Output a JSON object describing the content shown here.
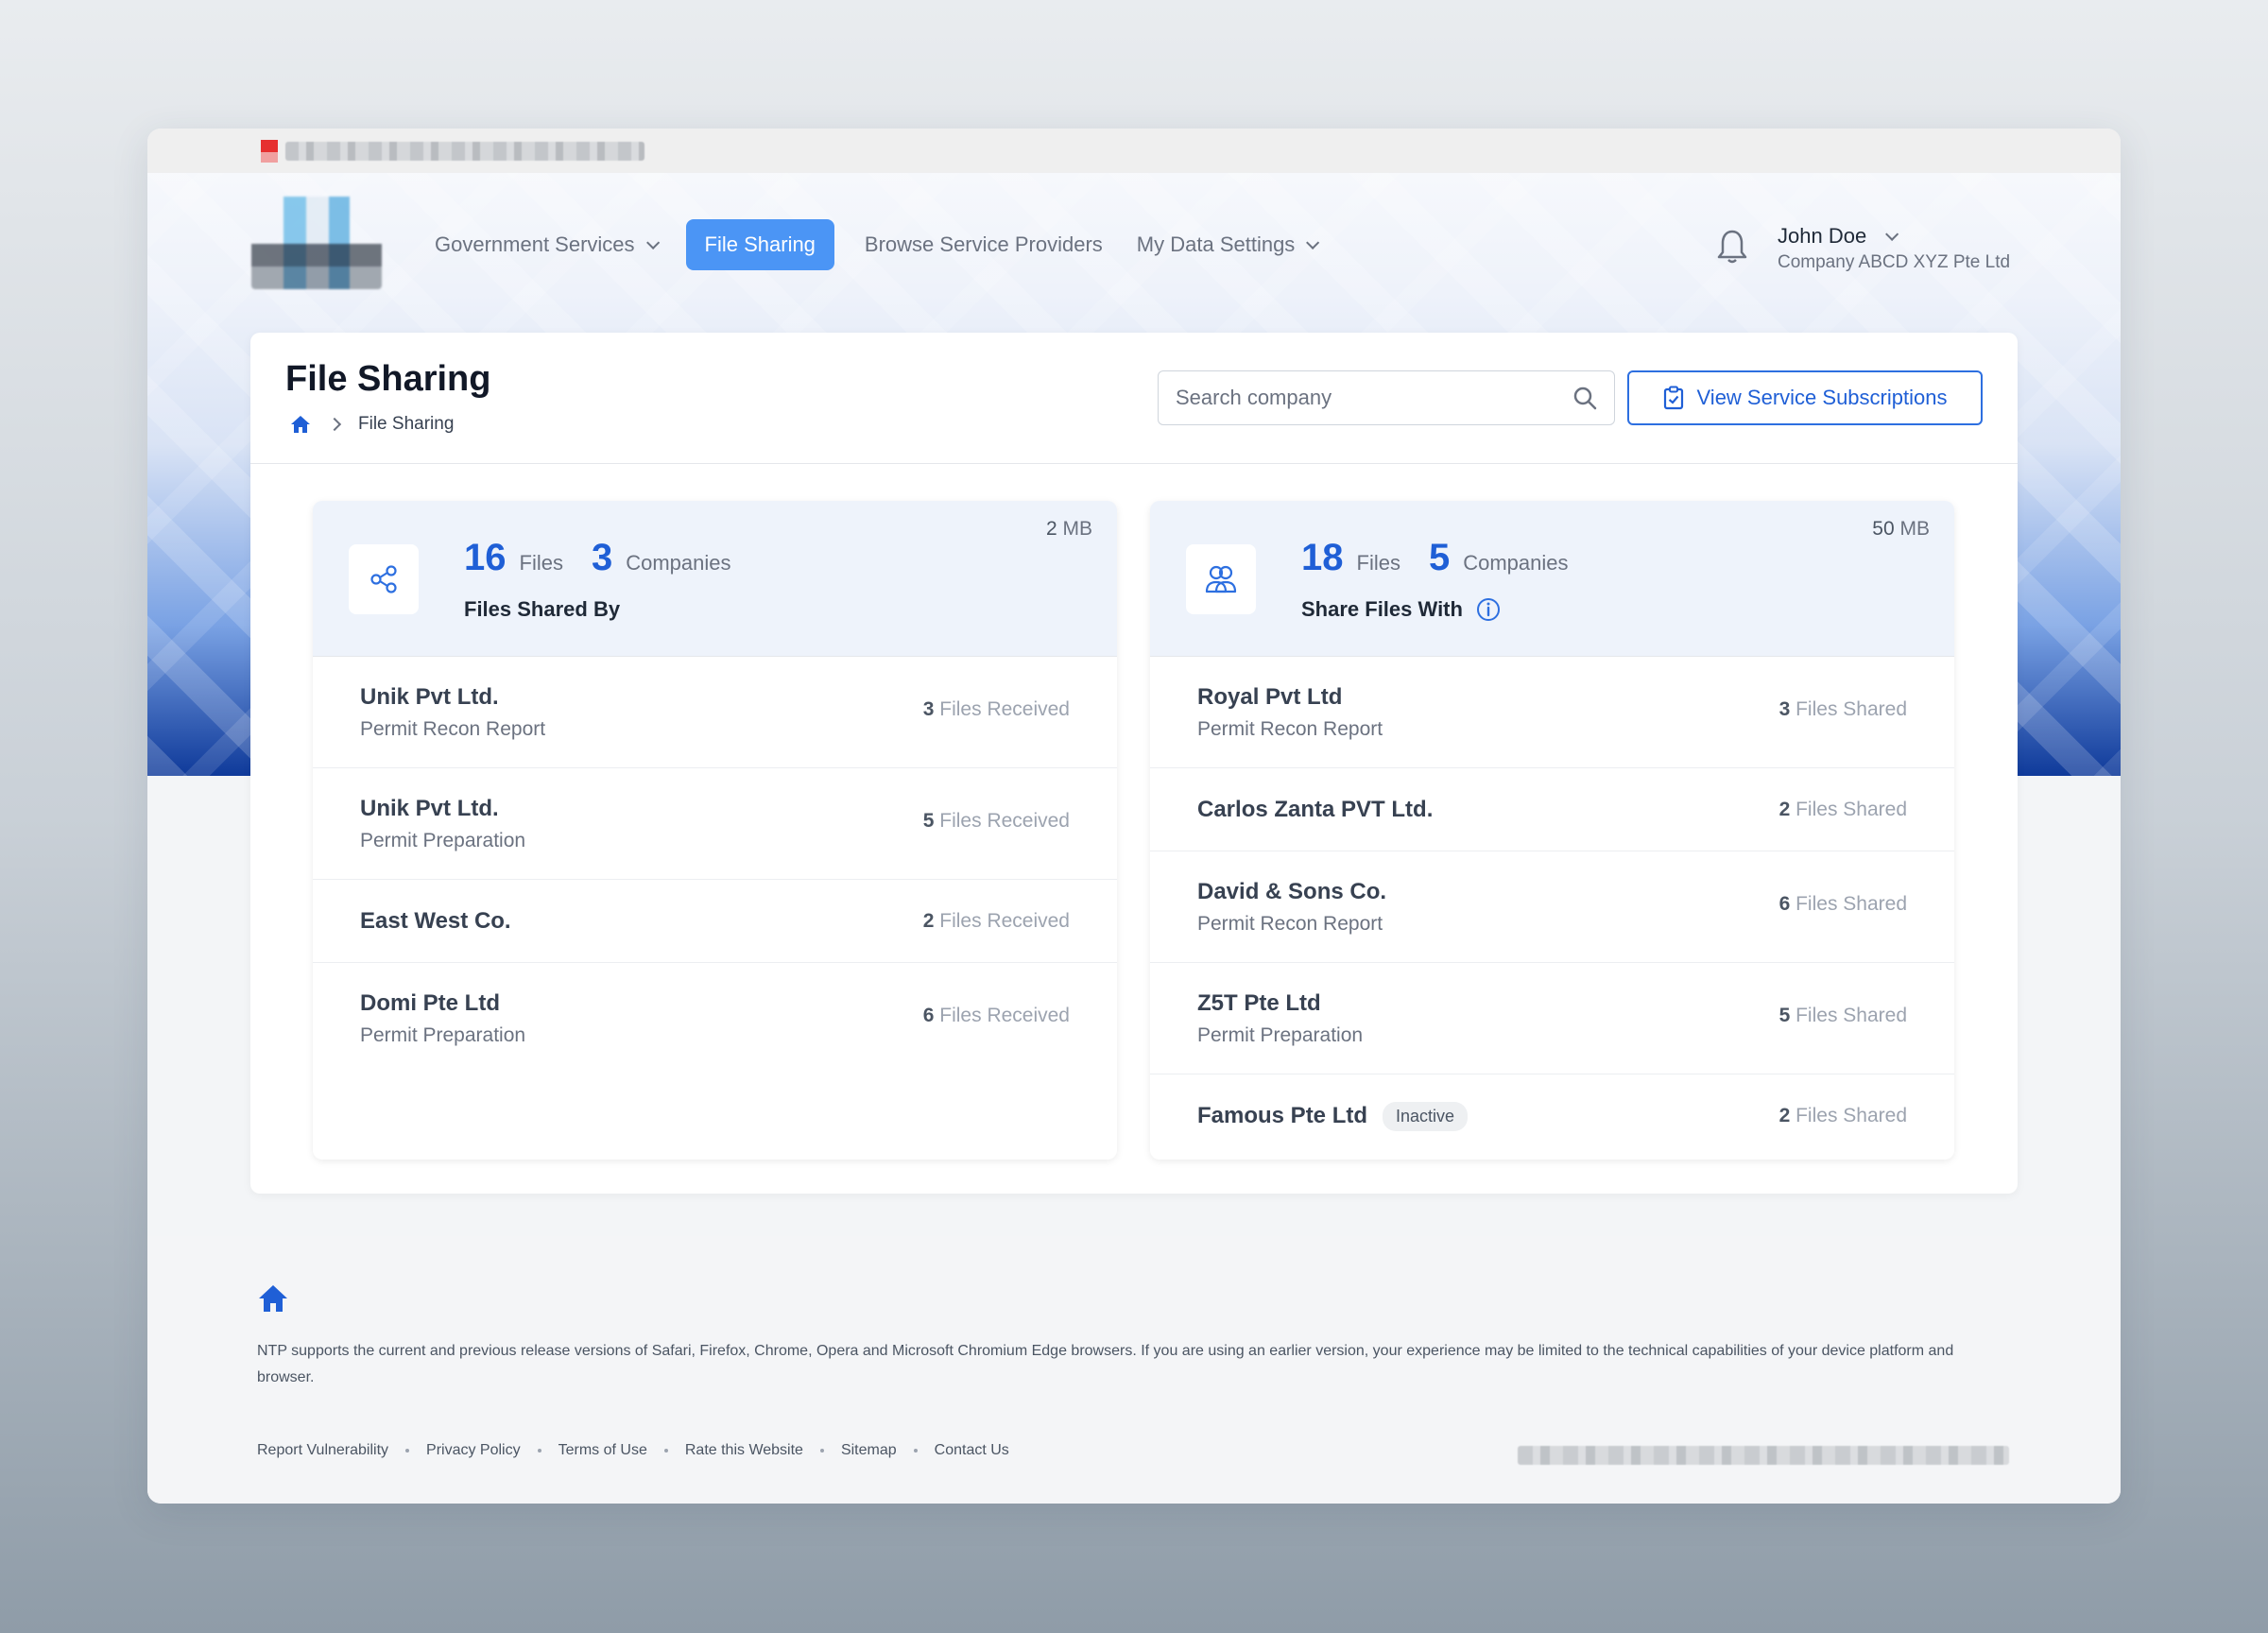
{
  "nav": {
    "items": [
      {
        "label": "Government Services",
        "dropdown": true
      },
      {
        "label": "File Sharing",
        "active": true
      },
      {
        "label": "Browse Service Providers"
      },
      {
        "label": "My Data Settings",
        "dropdown": true
      }
    ]
  },
  "user": {
    "name": "John Doe",
    "company": "Company ABCD XYZ Pte Ltd"
  },
  "page": {
    "title": "File Sharing",
    "breadcrumb": "File Sharing"
  },
  "search": {
    "placeholder": "Search company"
  },
  "subscriptions_button": "View Service Subscriptions",
  "shared_by": {
    "files": "16",
    "files_label": "Files",
    "companies": "3",
    "companies_label": "Companies",
    "title": "Files Shared By",
    "size_value": "2",
    "size_unit": "MB",
    "rows": [
      {
        "company": "Unik Pvt Ltd.",
        "detail": "Permit Recon Report",
        "count": "3",
        "count_label": "Files Received"
      },
      {
        "company": "Unik Pvt Ltd.",
        "detail": "Permit Preparation",
        "count": "5",
        "count_label": "Files Received"
      },
      {
        "company": "East West Co.",
        "detail": "",
        "count": "2",
        "count_label": "Files Received"
      },
      {
        "company": "Domi Pte Ltd",
        "detail": "Permit Preparation",
        "count": "6",
        "count_label": "Files Received"
      }
    ]
  },
  "share_with": {
    "files": "18",
    "files_label": "Files",
    "companies": "5",
    "companies_label": "Companies",
    "title": "Share Files With",
    "size_value": "50",
    "size_unit": "MB",
    "rows": [
      {
        "company": "Royal Pvt Ltd",
        "detail": "Permit Recon Report",
        "count": "3",
        "count_label": "Files Shared"
      },
      {
        "company": "Carlos Zanta PVT Ltd.",
        "detail": "",
        "count": "2",
        "count_label": "Files Shared"
      },
      {
        "company": "David & Sons Co.",
        "detail": "Permit Recon Report",
        "count": "6",
        "count_label": "Files Shared"
      },
      {
        "company": "Z5T Pte Ltd",
        "detail": "Permit Preparation",
        "count": "5",
        "count_label": "Files Shared"
      },
      {
        "company": "Famous Pte Ltd",
        "badge": "Inactive",
        "detail": "",
        "count": "2",
        "count_label": "Files Shared"
      }
    ]
  },
  "footer": {
    "notice": "NTP supports the current and previous release versions of Safari, Firefox, Chrome, Opera and Microsoft Chromium Edge browsers. If you are using an earlier version, your experience may be limited to the technical capabilities of your device platform and browser.",
    "links": [
      "Report Vulnerability",
      "Privacy Policy",
      "Terms of Use",
      "Rate this Website",
      "Sitemap",
      "Contact Us"
    ]
  },
  "colors": {
    "accent": "#1f5fd6",
    "active_nav": "#4b95f5",
    "card_header": "#eef3fb"
  }
}
